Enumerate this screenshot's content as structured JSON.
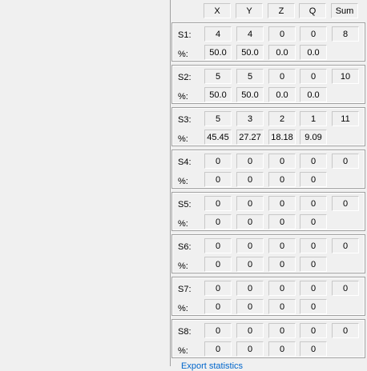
{
  "columns": [
    "X",
    "Y",
    "Z",
    "Q",
    "Sum"
  ],
  "rows": [
    {
      "label": "S1:",
      "pct_label": "%:",
      "counts": [
        "4",
        "4",
        "0",
        "0"
      ],
      "sum": "8",
      "pcts": [
        "50.0",
        "50.0",
        "0.0",
        "0.0"
      ]
    },
    {
      "label": "S2:",
      "pct_label": "%:",
      "counts": [
        "5",
        "5",
        "0",
        "0"
      ],
      "sum": "10",
      "pcts": [
        "50.0",
        "50.0",
        "0.0",
        "0.0"
      ]
    },
    {
      "label": "S3:",
      "pct_label": "%:",
      "counts": [
        "5",
        "3",
        "2",
        "1"
      ],
      "sum": "11",
      "pcts": [
        "45.45",
        "27.27",
        "18.18",
        "9.09"
      ]
    },
    {
      "label": "S4:",
      "pct_label": "%:",
      "counts": [
        "0",
        "0",
        "0",
        "0"
      ],
      "sum": "0",
      "pcts": [
        "0",
        "0",
        "0",
        "0"
      ]
    },
    {
      "label": "S5:",
      "pct_label": "%:",
      "counts": [
        "0",
        "0",
        "0",
        "0"
      ],
      "sum": "0",
      "pcts": [
        "0",
        "0",
        "0",
        "0"
      ]
    },
    {
      "label": "S6:",
      "pct_label": "%:",
      "counts": [
        "0",
        "0",
        "0",
        "0"
      ],
      "sum": "0",
      "pcts": [
        "0",
        "0",
        "0",
        "0"
      ]
    },
    {
      "label": "S7:",
      "pct_label": "%:",
      "counts": [
        "0",
        "0",
        "0",
        "0"
      ],
      "sum": "0",
      "pcts": [
        "0",
        "0",
        "0",
        "0"
      ]
    },
    {
      "label": "S8:",
      "pct_label": "%:",
      "counts": [
        "0",
        "0",
        "0",
        "0"
      ],
      "sum": "0",
      "pcts": [
        "0",
        "0",
        "0",
        "0"
      ]
    }
  ],
  "footer": {
    "link_text": "Export statistics"
  }
}
